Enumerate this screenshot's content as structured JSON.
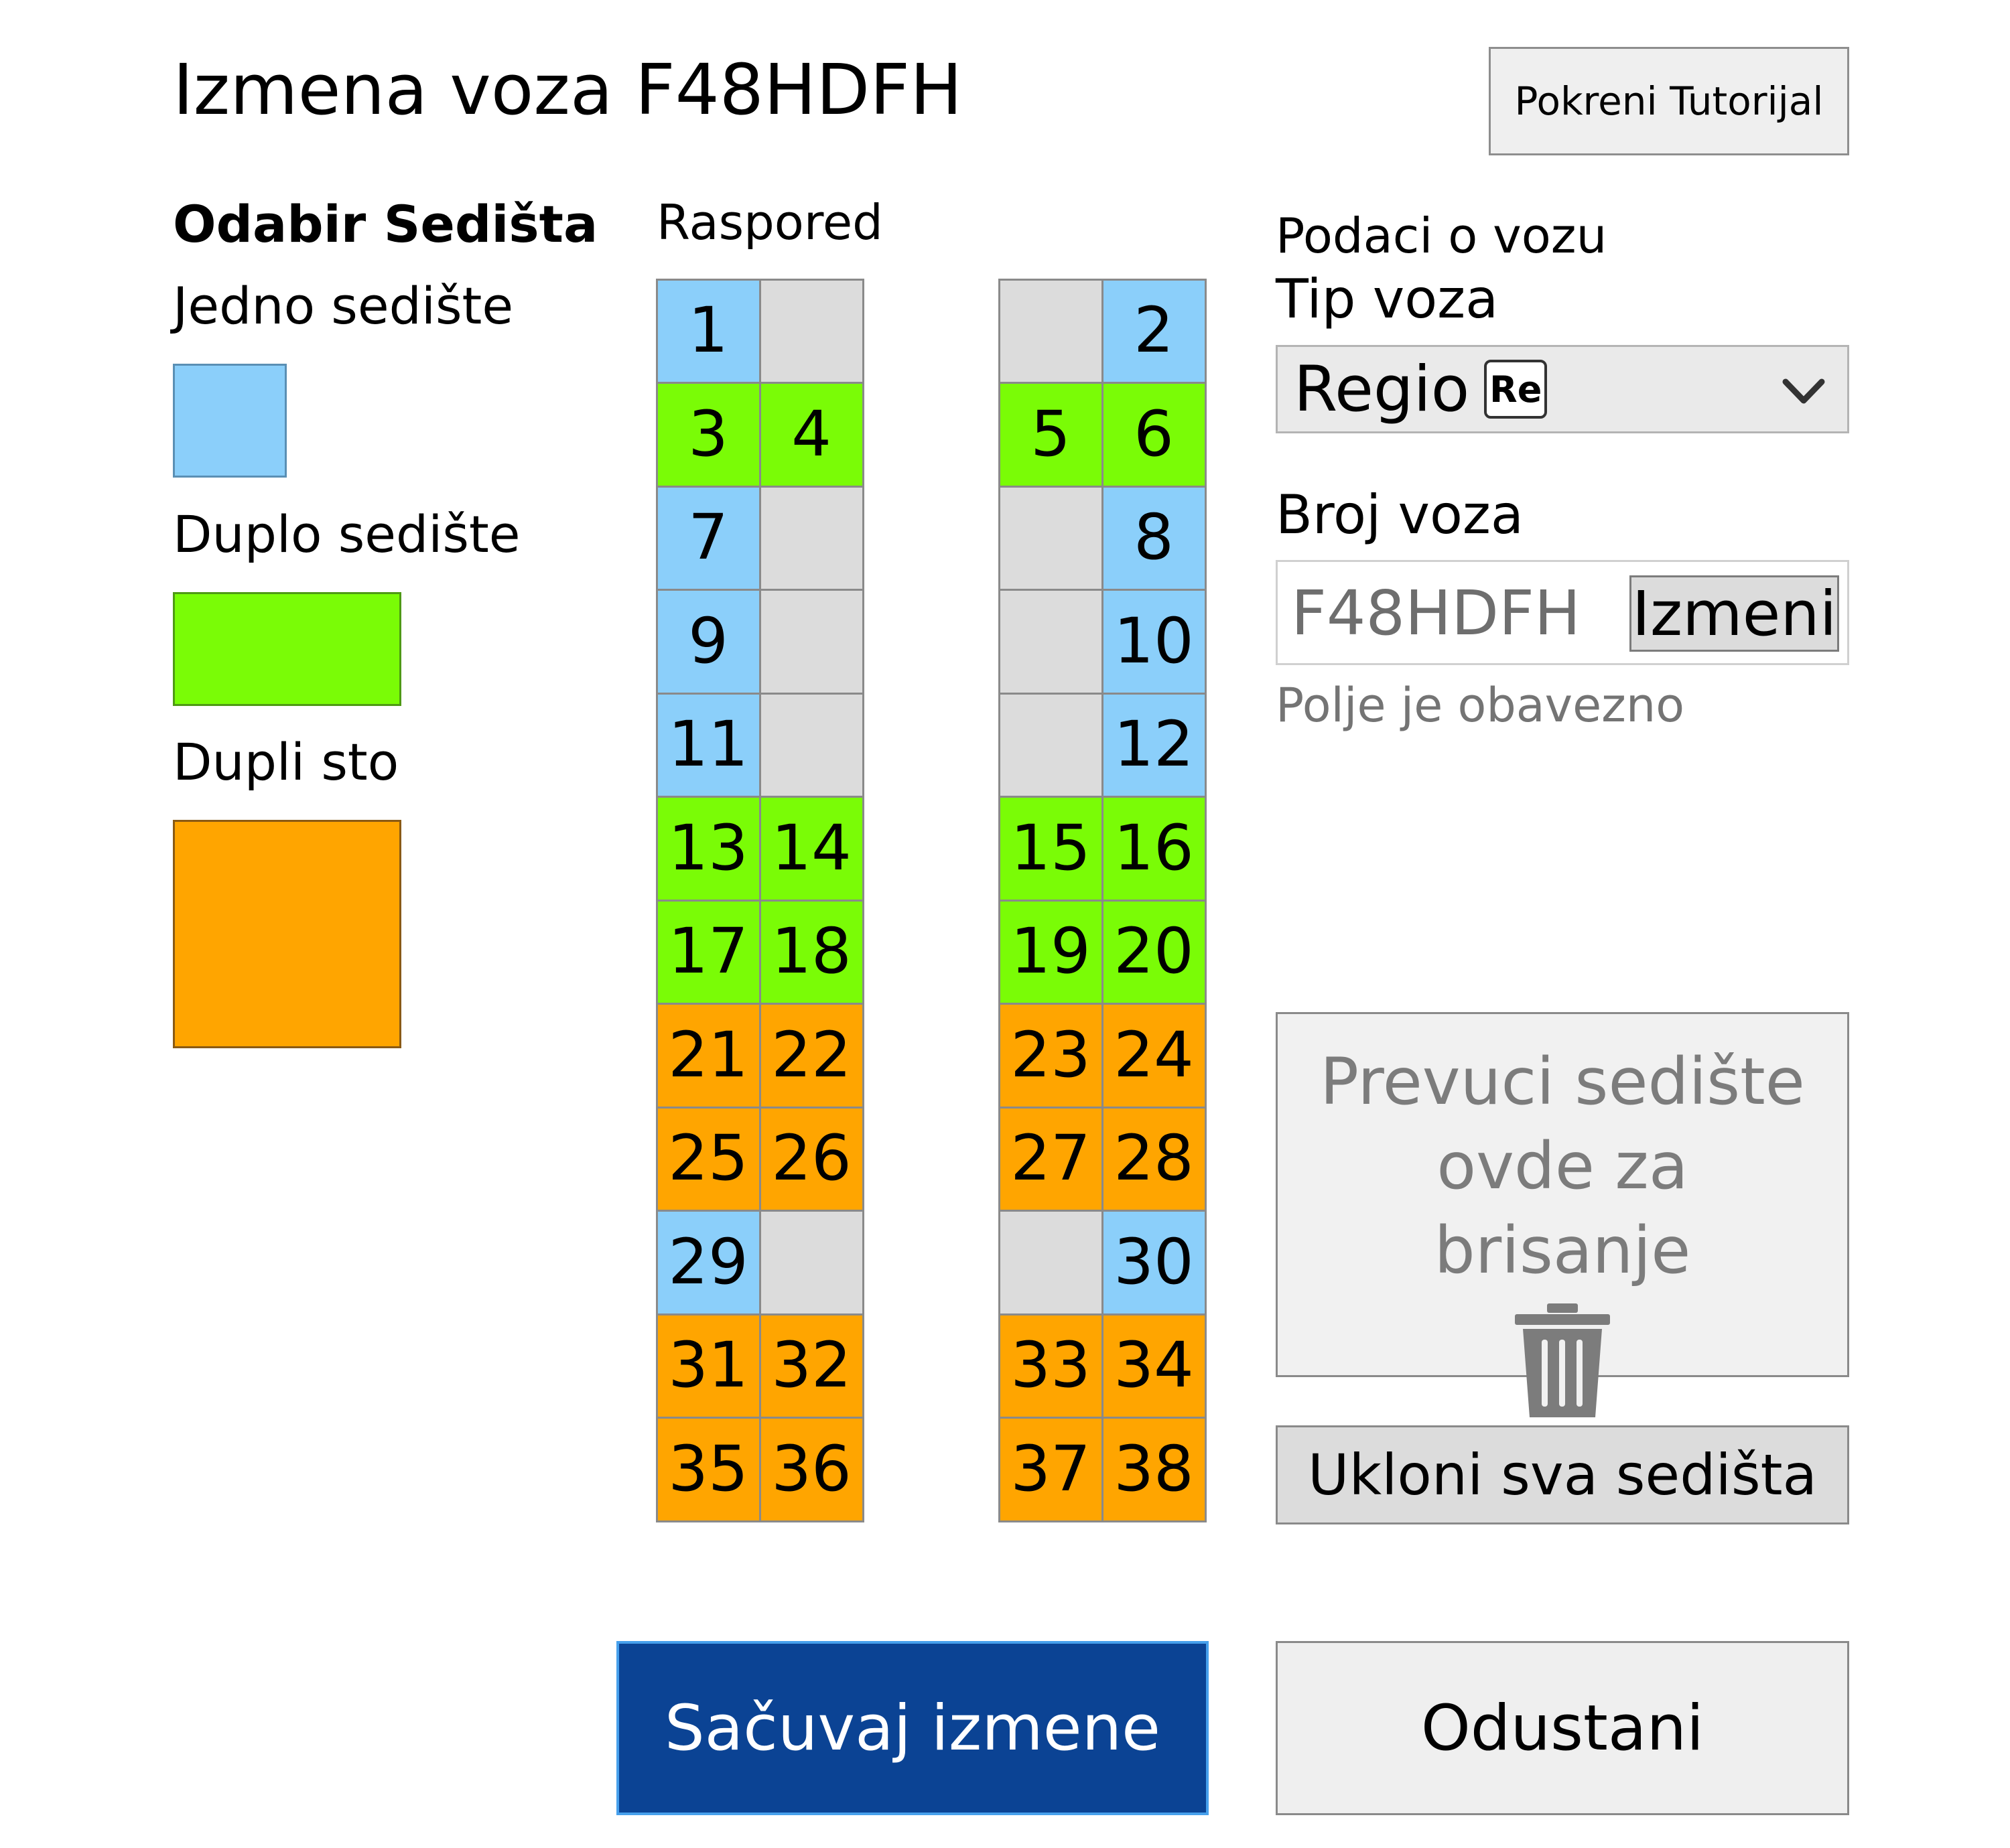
{
  "page": {
    "title": "Izmena voza F48HDFH"
  },
  "header": {
    "tutorial_button": "Pokreni Tutorijal"
  },
  "seat_selection": {
    "title": "Odabir Sedišta",
    "single_label": "Jedno sedište",
    "double_label": "Duplo sedište",
    "table_label": "Dupli sto"
  },
  "layout": {
    "title": "Raspored",
    "left_rows": [
      [
        {
          "type": "single",
          "label": "1"
        },
        {
          "type": "empty",
          "label": ""
        }
      ],
      [
        {
          "type": "double",
          "label": "3"
        },
        {
          "type": "double",
          "label": "4"
        }
      ],
      [
        {
          "type": "single",
          "label": "7"
        },
        {
          "type": "empty",
          "label": ""
        }
      ],
      [
        {
          "type": "single",
          "label": "9"
        },
        {
          "type": "empty",
          "label": ""
        }
      ],
      [
        {
          "type": "single",
          "label": "11"
        },
        {
          "type": "empty",
          "label": ""
        }
      ],
      [
        {
          "type": "double",
          "label": "13"
        },
        {
          "type": "double",
          "label": "14"
        }
      ],
      [
        {
          "type": "double",
          "label": "17"
        },
        {
          "type": "double",
          "label": "18"
        }
      ],
      [
        {
          "type": "table",
          "label": "21"
        },
        {
          "type": "table",
          "label": "22"
        }
      ],
      [
        {
          "type": "table",
          "label": "25"
        },
        {
          "type": "table",
          "label": "26"
        }
      ],
      [
        {
          "type": "single",
          "label": "29"
        },
        {
          "type": "empty",
          "label": ""
        }
      ],
      [
        {
          "type": "table",
          "label": "31"
        },
        {
          "type": "table",
          "label": "32"
        }
      ],
      [
        {
          "type": "table",
          "label": "35"
        },
        {
          "type": "table",
          "label": "36"
        }
      ]
    ],
    "right_rows": [
      [
        {
          "type": "empty",
          "label": ""
        },
        {
          "type": "single",
          "label": "2"
        }
      ],
      [
        {
          "type": "double",
          "label": "5"
        },
        {
          "type": "double",
          "label": "6"
        }
      ],
      [
        {
          "type": "empty",
          "label": ""
        },
        {
          "type": "single",
          "label": "8"
        }
      ],
      [
        {
          "type": "empty",
          "label": ""
        },
        {
          "type": "single",
          "label": "10"
        }
      ],
      [
        {
          "type": "empty",
          "label": ""
        },
        {
          "type": "single",
          "label": "12"
        }
      ],
      [
        {
          "type": "double",
          "label": "15"
        },
        {
          "type": "double",
          "label": "16"
        }
      ],
      [
        {
          "type": "double",
          "label": "19"
        },
        {
          "type": "double",
          "label": "20"
        }
      ],
      [
        {
          "type": "table",
          "label": "23"
        },
        {
          "type": "table",
          "label": "24"
        }
      ],
      [
        {
          "type": "table",
          "label": "27"
        },
        {
          "type": "table",
          "label": "28"
        }
      ],
      [
        {
          "type": "empty",
          "label": ""
        },
        {
          "type": "single",
          "label": "30"
        }
      ],
      [
        {
          "type": "table",
          "label": "33"
        },
        {
          "type": "table",
          "label": "34"
        }
      ],
      [
        {
          "type": "table",
          "label": "37"
        },
        {
          "type": "table",
          "label": "38"
        }
      ]
    ]
  },
  "train_data": {
    "title": "Podaci o vozu",
    "type_label": "Tip voza",
    "type_value": "Regio",
    "type_badge": "Re",
    "number_label": "Broj voza",
    "number_value": "F48HDFH",
    "edit_button": "Izmeni",
    "required_hint": "Polje je obavezno"
  },
  "delete_zone": {
    "text": "Prevuci sedište ovde za brisanje",
    "icon": "trash-icon"
  },
  "actions": {
    "remove_all": "Ukloni sva sedišta",
    "save": "Sačuvaj izmene",
    "cancel": "Odustani"
  },
  "colors": {
    "single": "#8bcffa",
    "double": "#7afc06",
    "table": "#ffa500",
    "empty": "#dcdcdc",
    "primary": "#0b4394"
  }
}
